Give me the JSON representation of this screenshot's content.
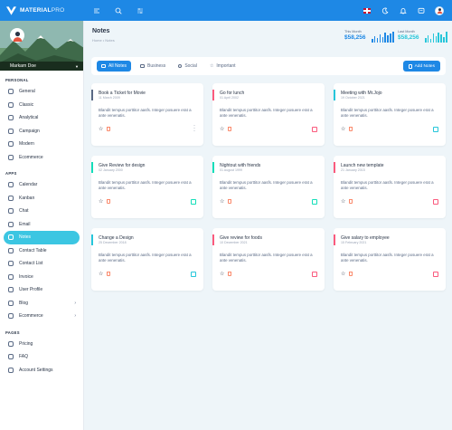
{
  "app": {
    "brand": "MATERIAL",
    "brand_suffix": "PRO"
  },
  "user": {
    "name": "Markarn Doe"
  },
  "sidebar": {
    "sections": [
      {
        "title": "PERSONAL",
        "items": [
          {
            "label": "General",
            "icon": "home-icon"
          },
          {
            "label": "Classic",
            "icon": "classic-icon"
          },
          {
            "label": "Analytical",
            "icon": "chart-pie-icon"
          },
          {
            "label": "Campaign",
            "icon": "campaign-icon"
          },
          {
            "label": "Modern",
            "icon": "modern-icon"
          },
          {
            "label": "Ecommerce",
            "icon": "cart-icon"
          }
        ]
      },
      {
        "title": "APPS",
        "items": [
          {
            "label": "Calendar",
            "icon": "calendar-icon"
          },
          {
            "label": "Kanban",
            "icon": "kanban-icon"
          },
          {
            "label": "Chat",
            "icon": "chat-icon"
          },
          {
            "label": "Email",
            "icon": "mail-icon"
          },
          {
            "label": "Notes",
            "icon": "notes-icon",
            "active": true
          },
          {
            "label": "Contact Table",
            "icon": "contact-table-icon"
          },
          {
            "label": "Contact List",
            "icon": "contact-list-icon"
          },
          {
            "label": "Invoice",
            "icon": "invoice-icon"
          },
          {
            "label": "User Profile",
            "icon": "user-icon"
          },
          {
            "label": "Blog",
            "icon": "blog-icon",
            "chevron": true
          },
          {
            "label": "Ecommerce",
            "icon": "basket-icon",
            "chevron": true
          }
        ]
      },
      {
        "title": "PAGES",
        "items": [
          {
            "label": "Pricing",
            "icon": "pricing-icon"
          },
          {
            "label": "FAQ",
            "icon": "faq-icon"
          },
          {
            "label": "Account Settings",
            "icon": "settings-icon"
          }
        ]
      }
    ]
  },
  "page": {
    "title": "Notes",
    "breadcrumb": [
      "Home",
      "Notes"
    ],
    "stats": [
      {
        "label": "This Month",
        "value": "$58,256",
        "color": "#1e88e5"
      },
      {
        "label": "Last Month",
        "value": "$58,256",
        "color": "#26c6da"
      }
    ]
  },
  "tabs": [
    {
      "label": "All Notes",
      "icon": "list-icon",
      "active": true
    },
    {
      "label": "Business",
      "icon": "briefcase-icon"
    },
    {
      "label": "Social",
      "icon": "share-icon"
    },
    {
      "label": "Important",
      "icon": "star-icon"
    }
  ],
  "add_button": "Add Notes",
  "notes": [
    {
      "title": "Book a Ticket for Movie",
      "date": "11 March 2009",
      "text": "Blandit tempus porttitor aasfs. Integer posuere erat a ante venenatis.",
      "color": "#5a6a85",
      "more": true
    },
    {
      "title": "Go for lunch",
      "date": "01 April 2002",
      "text": "Blandit tempus porttitor aasfs. Integer posuere erat a ante venenatis.",
      "color": "#fa5a7d"
    },
    {
      "title": "Meeting with Mr.Jojo",
      "date": "19 October 2021",
      "text": "Blandit tempus porttitor aasfs. Integer posuere erat a ante venenatis.",
      "color": "#26c6da"
    },
    {
      "title": "Give Review for design",
      "date": "02 January 2000",
      "text": "Blandit tempus porttitor aasfs. Integer posuere erat a ante venenatis.",
      "color": "#13deb9"
    },
    {
      "title": "Nightout with friends",
      "date": "01 August 1999",
      "text": "Blandit tempus porttitor aasfs. Integer posuere erat a ante venenatis.",
      "color": "#13deb9"
    },
    {
      "title": "Launch new template",
      "date": "21 January 2015",
      "text": "Blandit tempus porttitor aasfs. Integer posuere erat a ante venenatis.",
      "color": "#fa5a7d"
    },
    {
      "title": "Change a Design",
      "date": "25 December 2018",
      "text": "Blandit tempus porttitor aasfs. Integer posuere erat a ante venenatis.",
      "color": "#26c6da"
    },
    {
      "title": "Give review for foods",
      "date": "10 December 2021",
      "text": "Blandit tempus porttitor aasfs. Integer posuere erat a ante venenatis.",
      "color": "#fa5a7d"
    },
    {
      "title": "Give salary to employee",
      "date": "15 February 2021",
      "text": "Blandit tempus porttitor aasfs. Integer posuere erat a ante venenatis.",
      "color": "#fa5a7d"
    }
  ]
}
